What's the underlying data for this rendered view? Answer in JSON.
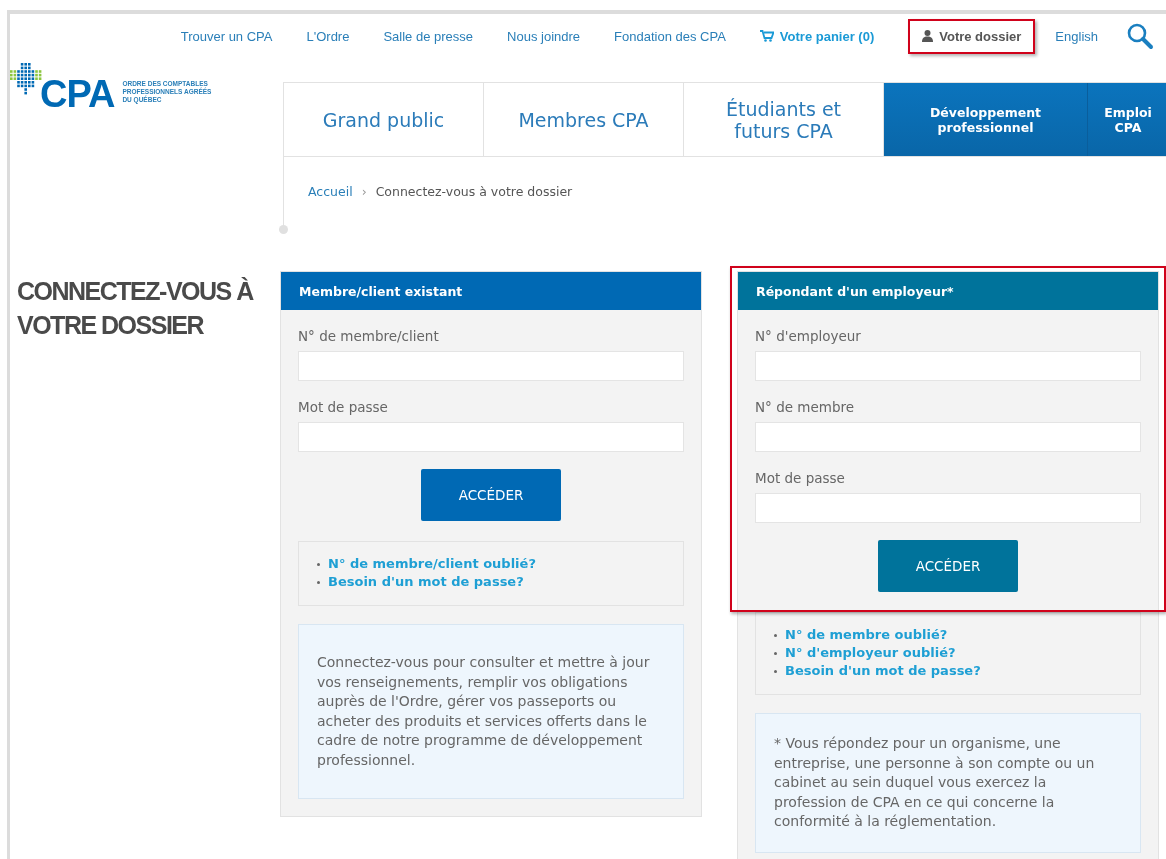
{
  "top_nav": {
    "links": [
      {
        "label": "Trouver un CPA",
        "kind": "link",
        "highlighted": false
      },
      {
        "label": "L'Ordre",
        "kind": "link",
        "highlighted": false
      },
      {
        "label": "Salle de presse",
        "kind": "link",
        "highlighted": false
      },
      {
        "label": "Nous joindre",
        "kind": "link",
        "highlighted": false
      },
      {
        "label": "Fondation des CPA",
        "kind": "link",
        "highlighted": false
      },
      {
        "label": "Votre panier (0)",
        "kind": "cart",
        "highlighted": false
      },
      {
        "label": "Votre dossier",
        "kind": "account",
        "highlighted": true
      },
      {
        "label": "English",
        "kind": "link",
        "highlighted": false
      }
    ]
  },
  "logo": {
    "wordmark": "CPA",
    "tagline_lines": [
      "ORDRE DES COMPTABLES",
      "PROFESSIONNELS AGRÉÉS",
      "DU QUÉBEC"
    ]
  },
  "main_nav": [
    {
      "label": "Grand public",
      "kind": "plain"
    },
    {
      "label": "Membres CPA",
      "kind": "plain"
    },
    {
      "label": "Étudiants et futurs CPA",
      "kind": "plain"
    },
    {
      "label": "Développement professionnel",
      "kind": "featured"
    },
    {
      "label": "Emploi CPA",
      "kind": "featured"
    }
  ],
  "breadcrumb": {
    "separator": "›",
    "items": [
      {
        "label": "Accueil",
        "kind": "link"
      },
      {
        "label": "Connectez-vous à votre dossier",
        "kind": "current"
      }
    ]
  },
  "heading": "CONNECTEZ-VOUS À VOTRE DOSSIER",
  "panels": [
    {
      "title": "Membre/client existant",
      "color": "#0069b4",
      "highlighted": false,
      "fields": [
        {
          "label": "N° de membre/client"
        },
        {
          "label": "Mot de passe"
        }
      ],
      "button": "ACCÉDER",
      "links": [
        "N° de membre/client oublié?",
        "Besoin d'un mot de passe?"
      ],
      "note": "Connectez-vous pour consulter et mettre à jour vos renseignements, remplir vos obligations auprès de l'Ordre, gérer vos passeports ou acheter des produits et services offerts dans le cadre de notre programme de développement professionnel."
    },
    {
      "title": "Répondant d'un employeur*",
      "color": "#00739b",
      "highlighted": true,
      "fields": [
        {
          "label": "N° d'employeur"
        },
        {
          "label": "N° de membre"
        },
        {
          "label": "Mot de passe"
        }
      ],
      "button": "ACCÉDER",
      "links": [
        "N° de membre oublié?",
        "N° d'employeur oublié?",
        "Besoin d'un mot de passe?"
      ],
      "note": "* Vous répondez pour un organisme, une entreprise, une personne à son compte ou un cabinet au sein duquel vous exercez la profession de CPA en ce qui concerne la conformité à la réglementation."
    }
  ]
}
